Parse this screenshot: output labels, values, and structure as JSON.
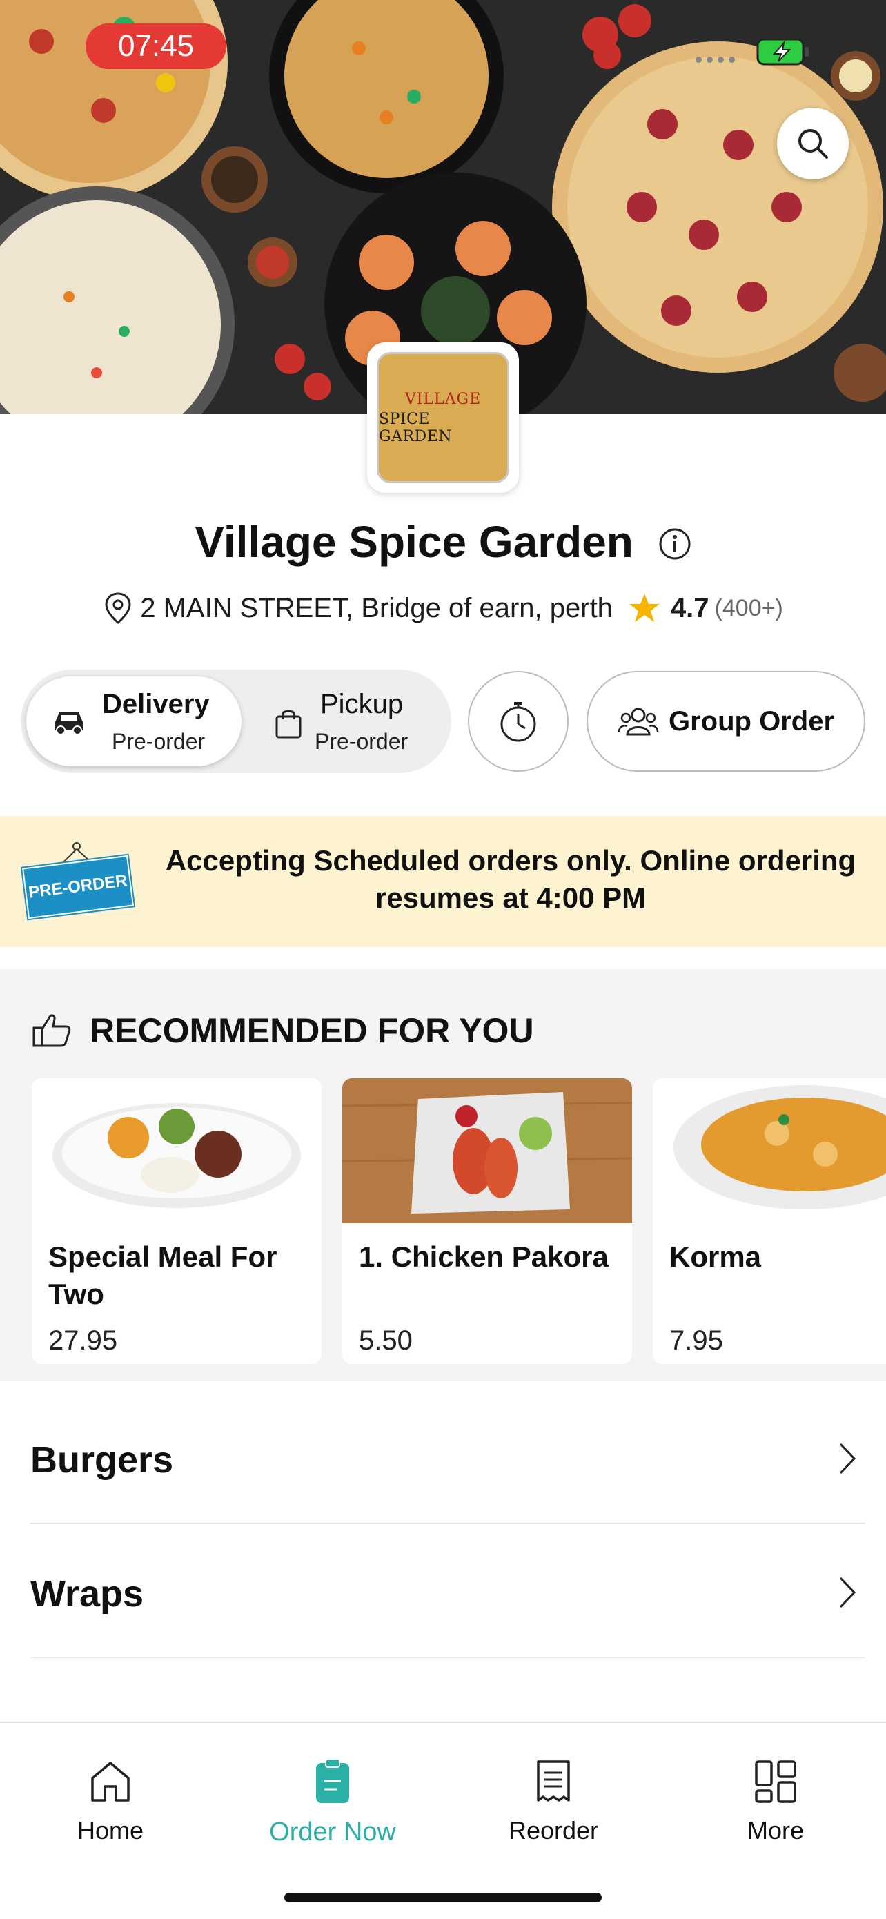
{
  "status_bar": {
    "time": "07:45"
  },
  "restaurant": {
    "logo_line1": "VILLAGE",
    "logo_line2": "SPICE GARDEN",
    "name": "Village Spice  Garden",
    "address": "2 MAIN STREET, Bridge of earn, perth",
    "rating": "4.7",
    "rating_count": "(400+)"
  },
  "order_modes": {
    "delivery": {
      "title": "Delivery",
      "subtitle": "Pre-order",
      "selected": true
    },
    "pickup": {
      "title": "Pickup",
      "subtitle": "Pre-order",
      "selected": false
    },
    "group_order_label": "Group Order"
  },
  "banner": {
    "tag": "PRE-ORDER",
    "message": "Accepting Scheduled orders only. Online ordering resumes at 4:00 PM"
  },
  "recommended": {
    "heading": "RECOMMENDED FOR YOU",
    "items": [
      {
        "name": "Special Meal For Two",
        "price": "27.95"
      },
      {
        "name": "1. Chicken Pakora",
        "price": "5.50"
      },
      {
        "name": "Korma",
        "price": "7.95"
      }
    ]
  },
  "categories": [
    {
      "label": "Burgers"
    },
    {
      "label": "Wraps"
    }
  ],
  "tab_bar": {
    "items": [
      {
        "label": "Home",
        "icon": "home-icon"
      },
      {
        "label": "Order Now",
        "icon": "order-icon",
        "active": true
      },
      {
        "label": "Reorder",
        "icon": "receipt-icon"
      },
      {
        "label": "More",
        "icon": "grid-icon"
      }
    ]
  },
  "colors": {
    "accent": "#2bb0a6",
    "banner_bg": "#fdf3d0",
    "star": "#f5b400",
    "time_pill": "#e53935"
  }
}
